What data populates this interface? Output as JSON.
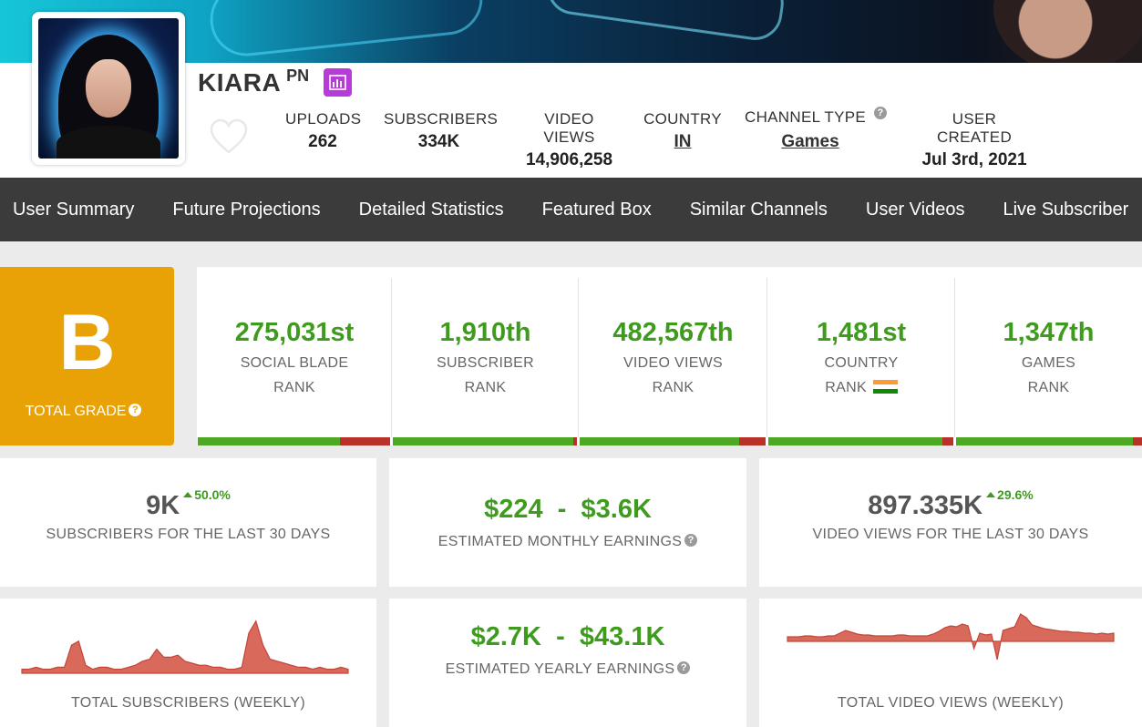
{
  "channel": {
    "name": "KIARA",
    "name_suffix": "PN"
  },
  "stats": [
    {
      "label": "UPLOADS",
      "value": "262"
    },
    {
      "label": "SUBSCRIBERS",
      "value": "334K"
    },
    {
      "label": "VIDEO VIEWS",
      "value": "14,906,258"
    },
    {
      "label": "COUNTRY",
      "value": "IN"
    },
    {
      "label": "CHANNEL TYPE",
      "value": "Games"
    },
    {
      "label": "USER CREATED",
      "value": "Jul 3rd, 2021"
    }
  ],
  "nav": {
    "items": [
      "User Summary",
      "Future Projections",
      "Detailed Statistics",
      "Featured Box",
      "Similar Channels",
      "User Videos",
      "Live Subscriber"
    ]
  },
  "grade": {
    "letter": "B",
    "label": "TOTAL GRADE"
  },
  "ranks": [
    {
      "value": "275,031st",
      "line1": "SOCIAL BLADE",
      "line2": "RANK",
      "progress": 0.74
    },
    {
      "value": "1,910th",
      "line1": "SUBSCRIBER",
      "line2": "RANK",
      "progress": 0.98
    },
    {
      "value": "482,567th",
      "line1": "VIDEO VIEWS",
      "line2": "RANK",
      "progress": 0.86
    },
    {
      "value": "1,481st",
      "line1": "COUNTRY",
      "line2": "RANK",
      "progress": 0.94
    },
    {
      "value": "1,347th",
      "line1": "GAMES",
      "line2": "RANK",
      "progress": 0.95
    }
  ],
  "cards": {
    "subs30": {
      "value": "9K",
      "change": "50.0%",
      "caption": "SUBSCRIBERS FOR THE LAST 30 DAYS"
    },
    "monthly": {
      "low": "$224",
      "dash": "-",
      "high": "$3.6K",
      "caption": "ESTIMATED MONTHLY EARNINGS"
    },
    "views30": {
      "value": "897.335K",
      "change": "29.6%",
      "caption": "VIDEO VIEWS FOR THE LAST 30 DAYS"
    },
    "subs_weekly": {
      "caption": "TOTAL SUBSCRIBERS (WEEKLY)"
    },
    "yearly": {
      "low": "$2.7K",
      "dash": "-",
      "high": "$43.1K",
      "caption": "ESTIMATED YEARLY EARNINGS"
    },
    "views_weekly": {
      "caption": "TOTAL VIDEO VIEWS (WEEKLY)"
    }
  },
  "sparklines": {
    "subs_weekly": [
      2,
      2,
      3,
      2,
      2,
      3,
      3,
      14,
      16,
      4,
      2,
      3,
      3,
      2,
      2,
      3,
      4,
      6,
      7,
      12,
      8,
      8,
      9,
      6,
      5,
      4,
      4,
      3,
      3,
      2,
      2,
      3,
      20,
      26,
      14,
      7,
      6,
      5,
      4,
      3,
      3,
      2,
      3,
      2,
      2,
      3,
      2
    ],
    "views_weekly": [
      5,
      5,
      5,
      6,
      6,
      5,
      5,
      6,
      6,
      9,
      12,
      10,
      8,
      7,
      7,
      6,
      6,
      6,
      6,
      7,
      7,
      6,
      6,
      6,
      6,
      8,
      11,
      15,
      17,
      16,
      19,
      17,
      -8,
      9,
      7,
      8,
      -20,
      12,
      14,
      16,
      30,
      26,
      18,
      16,
      14,
      13,
      12,
      11,
      11,
      10,
      10,
      9,
      9,
      8,
      9,
      8,
      9
    ]
  },
  "colors": {
    "accent_green": "#3e9b1d",
    "grade_orange": "#e9a205",
    "badge_purple": "#b63bd9",
    "spark_fill": "#d9695b"
  }
}
